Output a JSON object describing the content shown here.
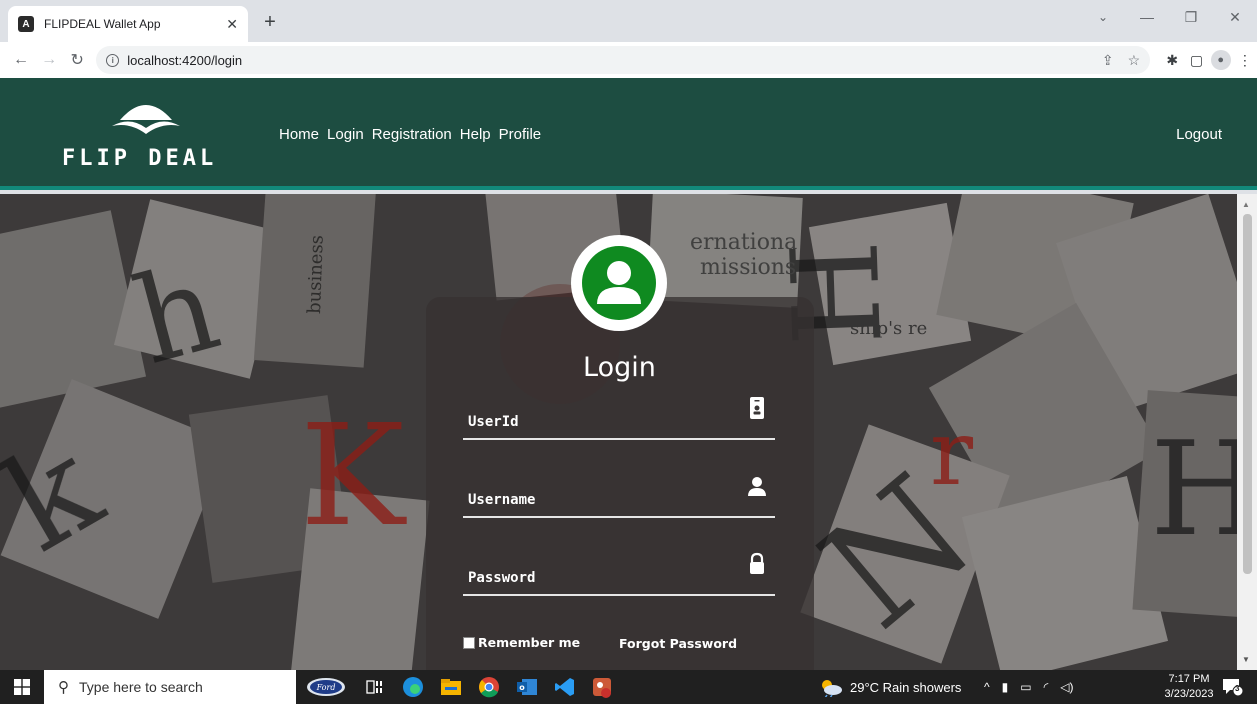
{
  "browser": {
    "tab_title": "FLIPDEAL Wallet App",
    "tab_favicon": "A",
    "url": "localhost:4200/login"
  },
  "header": {
    "logo_text": "FLIP DEAL",
    "nav": [
      "Home",
      "Login",
      "Registration",
      "Help",
      "Profile"
    ],
    "logout": "Logout"
  },
  "login": {
    "title": "Login",
    "fields": {
      "userid": "UserId",
      "username": "Username",
      "password": "Password"
    },
    "remember": "Remember me",
    "forgot": "Forgot Password"
  },
  "taskbar": {
    "search_placeholder": "Type here to search",
    "weather": "29°C  Rain showers",
    "time": "7:17 PM",
    "date": "3/23/2023",
    "notifications": "3"
  },
  "colors": {
    "header": "#1d4d41",
    "header_border": "#12897a",
    "avatar": "#0f8a20"
  }
}
